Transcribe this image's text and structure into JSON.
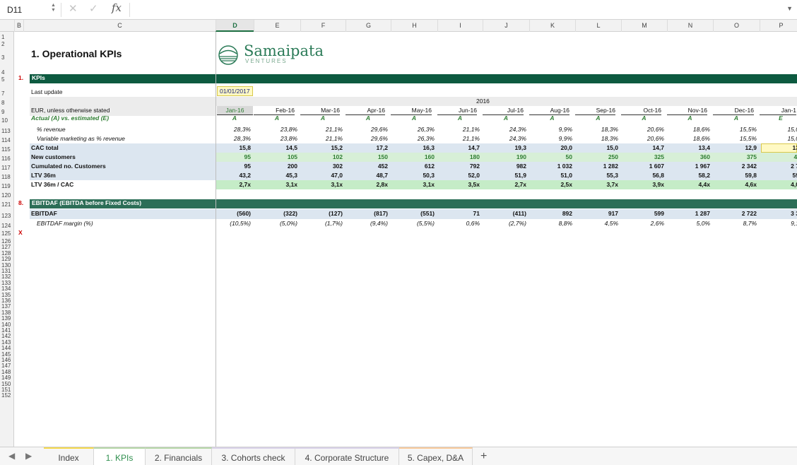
{
  "formula_bar": {
    "name_box": "D11",
    "fx": "fx"
  },
  "columns": [
    "B",
    "C",
    "D",
    "E",
    "F",
    "G",
    "H",
    "I",
    "J",
    "K",
    "L",
    "M",
    "N",
    "O",
    "P"
  ],
  "rows_top": [
    "1",
    "2",
    "3",
    "4",
    "5",
    "7",
    "8",
    "9",
    "10",
    "113",
    "114",
    "115",
    "116",
    "117",
    "118",
    "119",
    "120",
    "121",
    "123",
    "124",
    "125"
  ],
  "rows_empty": [
    "126",
    "127",
    "128",
    "129",
    "130",
    "131",
    "132",
    "133",
    "134",
    "135",
    "136",
    "137",
    "138",
    "139",
    "140",
    "141",
    "142",
    "143",
    "144",
    "145",
    "146",
    "147",
    "148",
    "149",
    "150",
    "151",
    "152"
  ],
  "title": "1. Operational KPIs",
  "logo": {
    "name": "Samaipata",
    "sub": "VENTURES"
  },
  "section1": {
    "number": "1.",
    "label": "KPIs"
  },
  "last_update": {
    "label": "Last update",
    "value": "01/01/2017"
  },
  "year": "2016",
  "eur_label": "EUR, unless otherwise stated",
  "actual_label": "Actual (A) vs. estimated (E)",
  "months": [
    "Jan-16",
    "Feb-16",
    "Mar-16",
    "Apr-16",
    "May-16",
    "Jun-16",
    "Jul-16",
    "Aug-16",
    "Sep-16",
    "Oct-16",
    "Nov-16",
    "Dec-16",
    "Jan-1"
  ],
  "ae": [
    "A",
    "A",
    "A",
    "A",
    "A",
    "A",
    "A",
    "A",
    "A",
    "A",
    "A",
    "A",
    "E"
  ],
  "kpi_rows": [
    {
      "label": "% revenue",
      "style": "italic",
      "values": [
        "28,3%",
        "23,8%",
        "21,1%",
        "29,6%",
        "26,3%",
        "21,1%",
        "24,3%",
        "9,9%",
        "18,3%",
        "20,6%",
        "18,6%",
        "15,5%",
        "15,0"
      ]
    },
    {
      "label": "Variable marketing as % revenue",
      "style": "italic",
      "values": [
        "28,3%",
        "23,8%",
        "21,1%",
        "29,6%",
        "26,3%",
        "21,1%",
        "24,3%",
        "9,9%",
        "18,3%",
        "20,6%",
        "18,6%",
        "15,5%",
        "15,0"
      ]
    },
    {
      "label": "CAC total",
      "style": "bold",
      "values": [
        "15,8",
        "14,5",
        "15,2",
        "17,2",
        "16,3",
        "14,7",
        "19,3",
        "20,0",
        "15,0",
        "14,7",
        "13,4",
        "12,9",
        "13"
      ]
    },
    {
      "label": "New customers",
      "style": "bold",
      "values": [
        "95",
        "105",
        "102",
        "150",
        "160",
        "180",
        "190",
        "50",
        "250",
        "325",
        "360",
        "375",
        "4:"
      ]
    },
    {
      "label": "Cumulated no. Customers",
      "style": "bold",
      "values": [
        "95",
        "200",
        "302",
        "452",
        "612",
        "792",
        "982",
        "1 032",
        "1 282",
        "1 607",
        "1 967",
        "2 342",
        "2 7"
      ]
    },
    {
      "label": "LTV 36m",
      "style": "bold",
      "values": [
        "43,2",
        "45,3",
        "47,0",
        "48,7",
        "50,3",
        "52,0",
        "51,9",
        "51,0",
        "55,3",
        "56,8",
        "58,2",
        "59,8",
        "59"
      ]
    },
    {
      "label": "LTV 36m / CAC",
      "style": "bold",
      "values": [
        "2,7x",
        "3,1x",
        "3,1x",
        "2,8x",
        "3,1x",
        "3,5x",
        "2,7x",
        "2,5x",
        "3,7x",
        "3,9x",
        "4,4x",
        "4,6x",
        "4,0"
      ]
    }
  ],
  "section8": {
    "number": "8.",
    "label": "EBITDAF (EBITDA before Fixed Costs)"
  },
  "ebitdaf": {
    "label": "EBITDAF",
    "values": [
      "(560)",
      "(322)",
      "(127)",
      "(817)",
      "(551)",
      "71",
      "(411)",
      "892",
      "917",
      "599",
      "1 287",
      "2 722",
      "3 3"
    ]
  },
  "ebitdaf_margin": {
    "label": "EBITDAF margin (%)",
    "values": [
      "(10,5%)",
      "(5,0%)",
      "(1,7%)",
      "(9,4%)",
      "(5,5%)",
      "0,6%",
      "(2,7%)",
      "8,8%",
      "4,5%",
      "2,6%",
      "5,0%",
      "8,7%",
      "9,1"
    ]
  },
  "x_marker": "X",
  "tabs": [
    "Index",
    "1. KPIs",
    "2. Financials",
    "3. Cohorts check",
    "4. Corporate Structure",
    "5. Capex, D&A"
  ],
  "add_sheet": "+",
  "colors": {
    "header_band": "#0d5a40",
    "section_band": "#2c6e57",
    "active_tab": "#2f8f4e",
    "kpi_fill": "#dce6f0",
    "ratio_fill": "#c5ecc7"
  }
}
